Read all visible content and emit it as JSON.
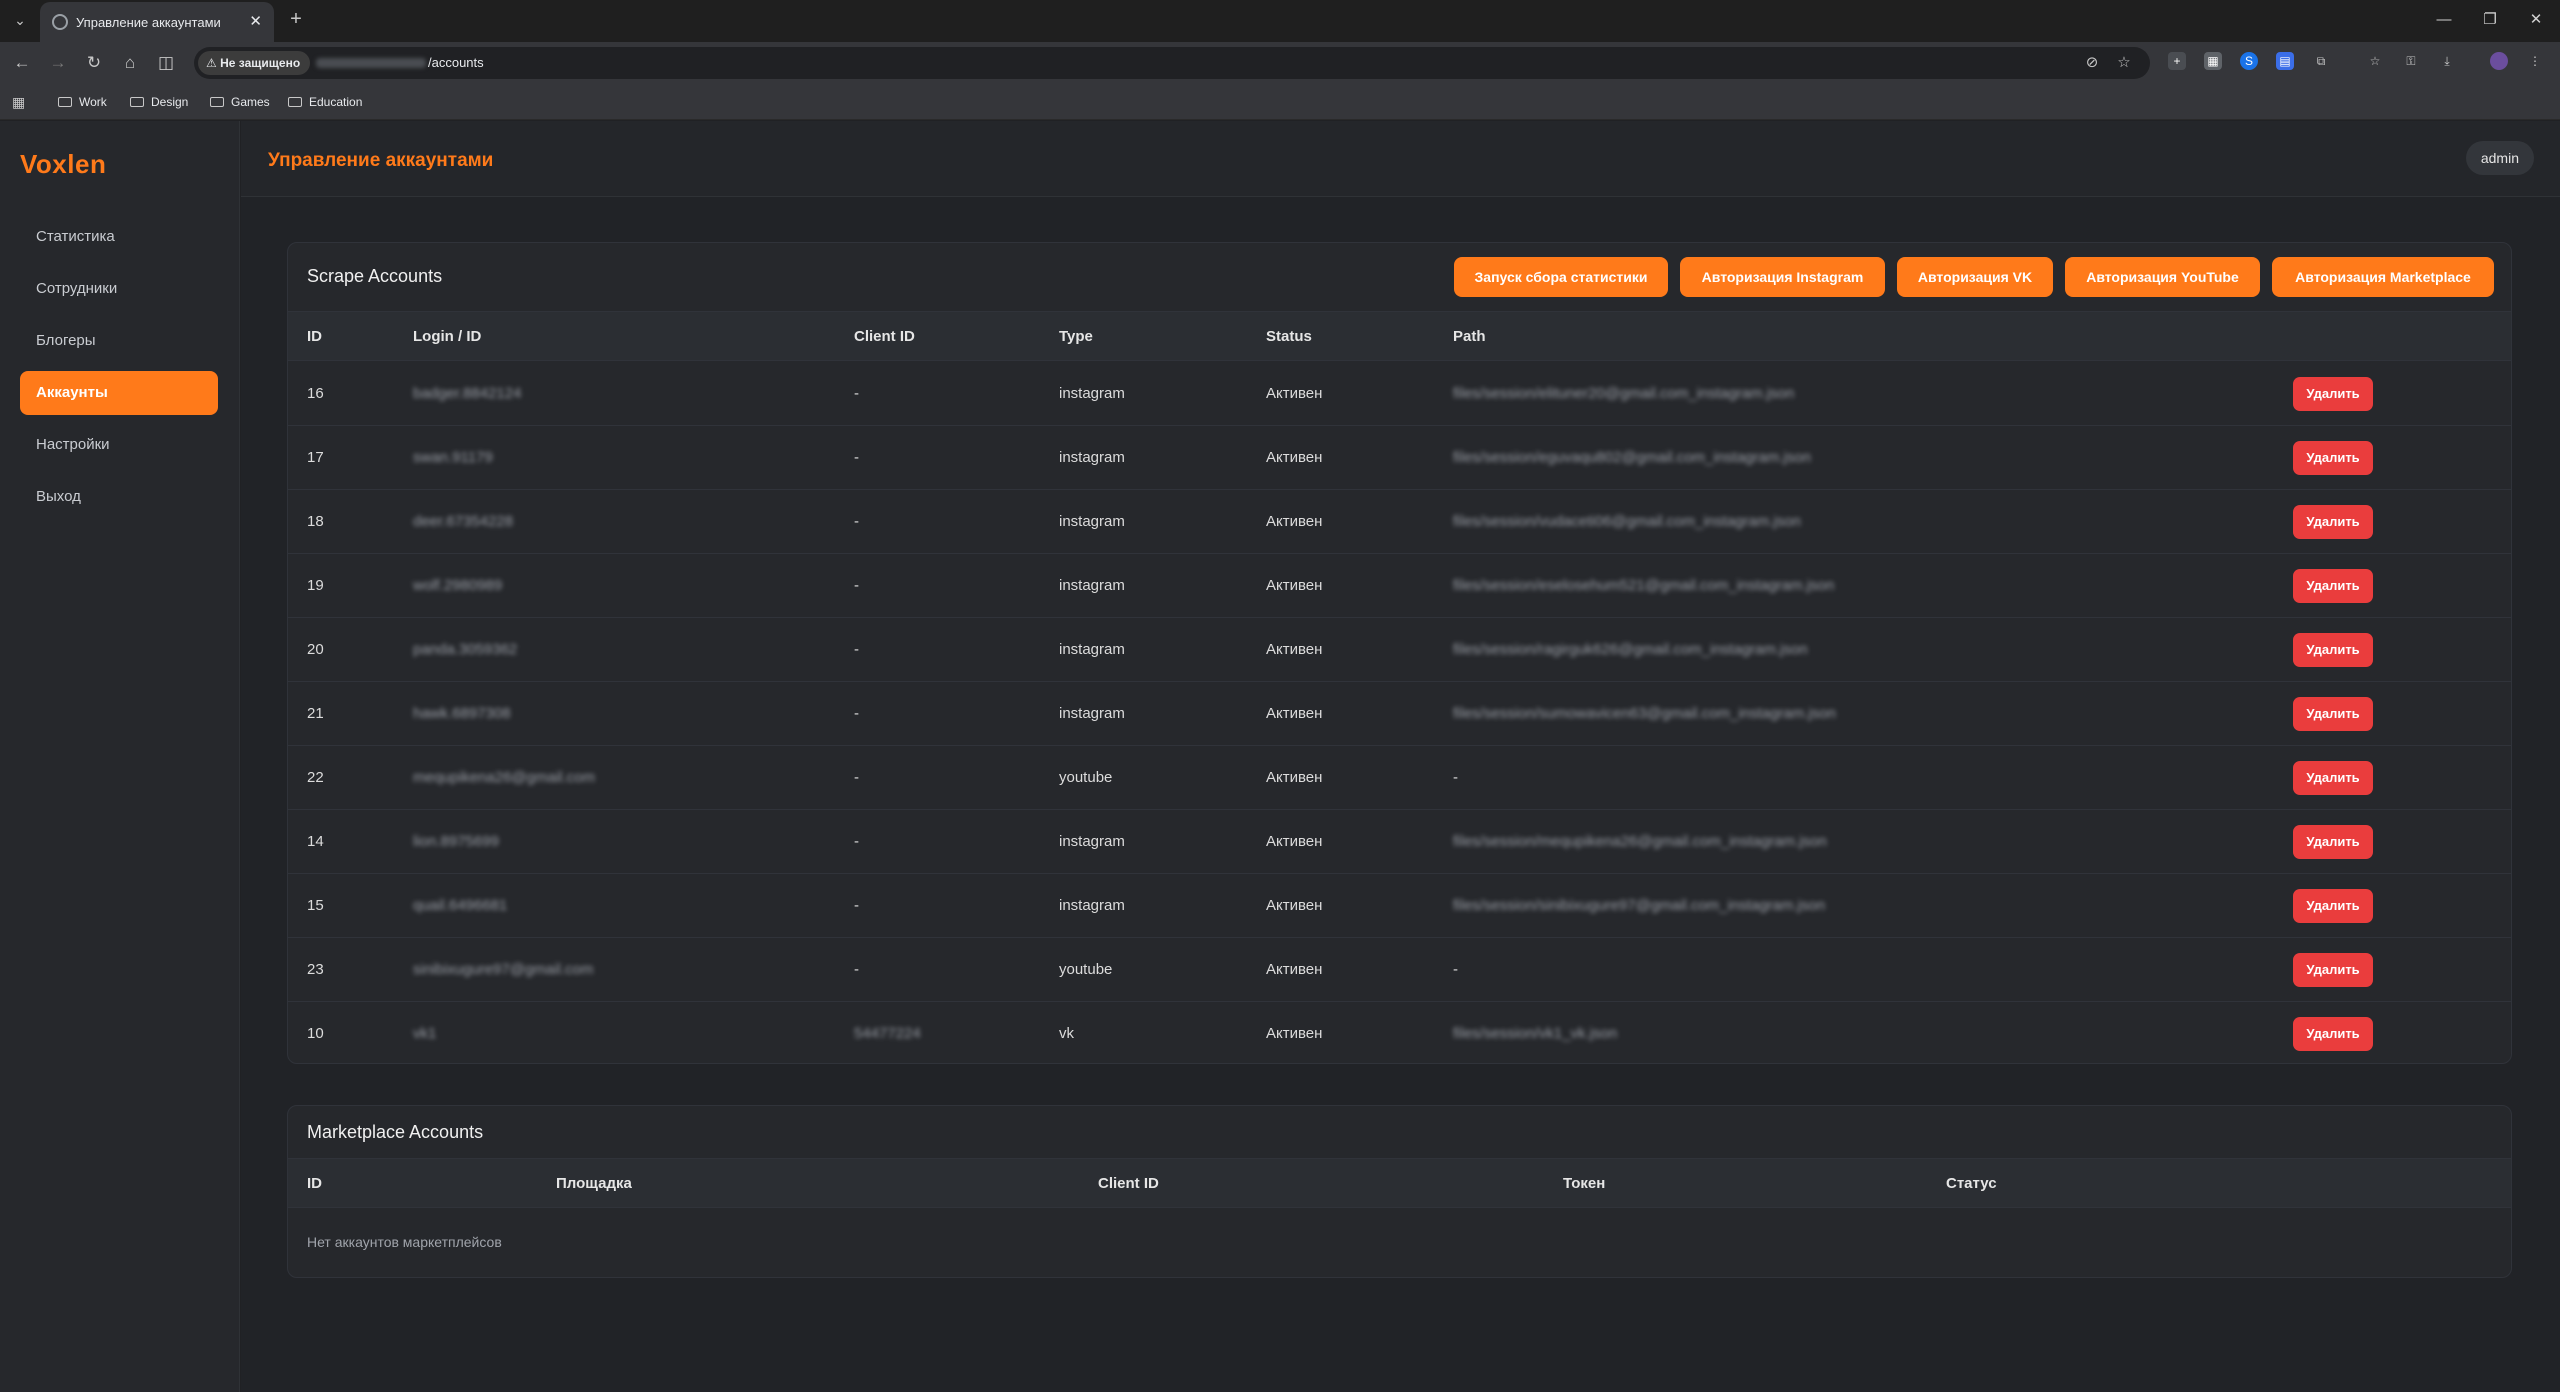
{
  "browser": {
    "tab_title": "Управление аккаунтами",
    "security_label": "Не защищено",
    "url_path": "/accounts",
    "bookmarks": [
      "Work",
      "Design",
      "Games",
      "Education"
    ]
  },
  "app": {
    "logo": "Voxlen",
    "page_title": "Управление аккаунтами",
    "user": "admin",
    "accent_color": "#ff7a1a",
    "danger_color": "#ea3d3d"
  },
  "sidebar": {
    "items": [
      {
        "label": "Статистика",
        "active": false
      },
      {
        "label": "Сотрудники",
        "active": false
      },
      {
        "label": "Блогеры",
        "active": false
      },
      {
        "label": "Аккаунты",
        "active": true
      },
      {
        "label": "Настройки",
        "active": false
      },
      {
        "label": "Выход",
        "active": false
      }
    ]
  },
  "scrape": {
    "title": "Scrape Accounts",
    "buttons": [
      "Запуск сбора статистики",
      "Авторизация Instagram",
      "Авторизация VK",
      "Авторизация YouTube",
      "Авторизация Marketplace"
    ],
    "columns": [
      "ID",
      "Login / ID",
      "Client ID",
      "Type",
      "Status",
      "Path"
    ],
    "delete_label": "Удалить",
    "rows": [
      {
        "id": "16",
        "login": "badger.8842124",
        "client": "-",
        "type": "instagram",
        "status": "Активен",
        "path": "files/session/elituner20@gmail.com_instagram.json"
      },
      {
        "id": "17",
        "login": "swan.91179",
        "client": "-",
        "type": "instagram",
        "status": "Активен",
        "path": "files/session/eguvaqu802@gmail.com_instagram.json"
      },
      {
        "id": "18",
        "login": "deer.67354228",
        "client": "-",
        "type": "instagram",
        "status": "Активен",
        "path": "files/session/vudaceti06@gmail.com_instagram.json"
      },
      {
        "id": "19",
        "login": "wolf.2980989",
        "client": "-",
        "type": "instagram",
        "status": "Активен",
        "path": "files/session/eselosehum521@gmail.com_instagram.json"
      },
      {
        "id": "20",
        "login": "panda.3059362",
        "client": "-",
        "type": "instagram",
        "status": "Активен",
        "path": "files/session/ragirguk626@gmail.com_instagram.json"
      },
      {
        "id": "21",
        "login": "hawk.6897308",
        "client": "-",
        "type": "instagram",
        "status": "Активен",
        "path": "files/session/sumowavicen63@gmail.com_instagram.json"
      },
      {
        "id": "22",
        "login": "mequpikena26@gmail.com",
        "client": "-",
        "type": "youtube",
        "status": "Активен",
        "path": "-"
      },
      {
        "id": "14",
        "login": "lion.8975699",
        "client": "-",
        "type": "instagram",
        "status": "Активен",
        "path": "files/session/mequpikena26@gmail.com_instagram.json"
      },
      {
        "id": "15",
        "login": "quail.6496681",
        "client": "-",
        "type": "instagram",
        "status": "Активен",
        "path": "files/session/sinibixugure97@gmail.com_instagram.json"
      },
      {
        "id": "23",
        "login": "sinibixugure97@gmail.com",
        "client": "-",
        "type": "youtube",
        "status": "Активен",
        "path": "-"
      },
      {
        "id": "10",
        "login": "vk1",
        "client": "54477224",
        "type": "vk",
        "status": "Активен",
        "path": "files/session/vk1_vk.json"
      }
    ]
  },
  "marketplace": {
    "title": "Marketplace Accounts",
    "columns": [
      "ID",
      "Площадка",
      "Client ID",
      "Токен",
      "Статус"
    ],
    "empty_text": "Нет аккаунтов маркетплейсов"
  }
}
